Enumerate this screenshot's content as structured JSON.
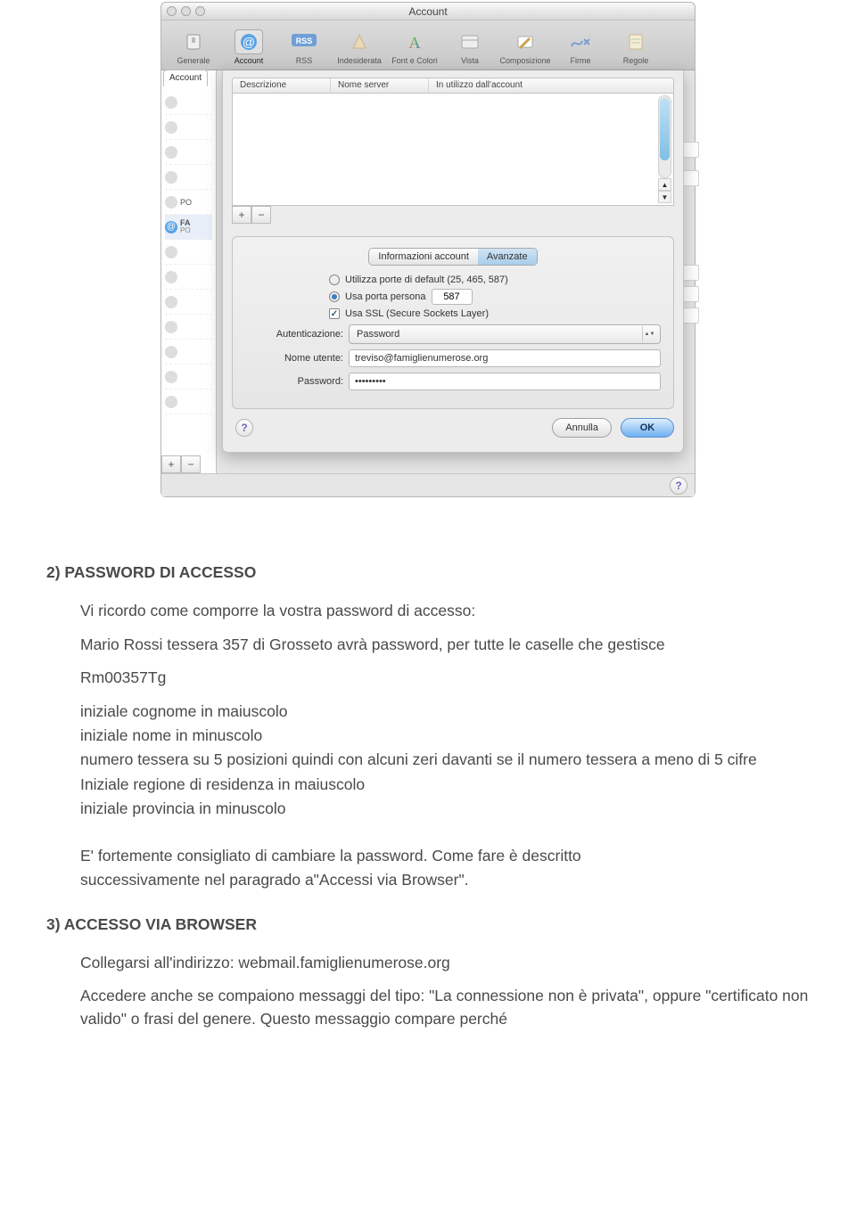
{
  "window": {
    "title": "Account"
  },
  "toolbar": {
    "items": [
      {
        "label": "Generale",
        "icon": "slider-icon"
      },
      {
        "label": "Account",
        "icon": "at-icon",
        "selected": true
      },
      {
        "label": "RSS",
        "icon": "rss-icon"
      },
      {
        "label": "Indesiderata",
        "icon": "junk-icon"
      },
      {
        "label": "Font e Colori",
        "icon": "font-icon"
      },
      {
        "label": "Vista",
        "icon": "view-icon"
      },
      {
        "label": "Composizione",
        "icon": "compose-icon"
      },
      {
        "label": "Firme",
        "icon": "sign-icon"
      },
      {
        "label": "Regole",
        "icon": "rules-icon"
      }
    ]
  },
  "sidebar": {
    "tab": "Account",
    "rows": [
      {
        "sub": "PO"
      },
      {
        "main": "FA",
        "sub": "PO"
      }
    ]
  },
  "table": {
    "headers": [
      "Descrizione",
      "Nome server",
      "In utilizzo dall'account"
    ]
  },
  "segmented": {
    "left": "Informazioni account",
    "right": "Avanzate"
  },
  "options": {
    "default_label": "Utilizza porte di default (25, 465, 587)",
    "custom_label": "Usa porta persona",
    "custom_value": "587",
    "ssl_label": "Usa SSL (Secure Sockets Layer)"
  },
  "form": {
    "auth_label": "Autenticazione:",
    "auth_value": "Password",
    "user_label": "Nome utente:",
    "user_value": "treviso@famiglienumerose.org",
    "pwd_label": "Password:",
    "pwd_value": "•••••••••"
  },
  "buttons": {
    "cancel": "Annulla",
    "ok": "OK",
    "plus": "+",
    "minus": "−",
    "help": "?"
  },
  "doc": {
    "h1": "2) PASSWORD DI ACCESSO",
    "p1": "Vi ricordo come comporre la vostra password di accesso:",
    "p2": "Mario Rossi tessera 357 di Grosseto avrà password, per tutte le caselle che gestisce",
    "p3": "Rm00357Tg",
    "l1": "iniziale cognome in maiuscolo",
    "l2": "iniziale nome in minuscolo",
    "l3": "numero tessera su 5 posizioni quindi con alcuni zeri davanti se il numero tessera a meno di 5 cifre",
    "l4": "Iniziale regione di residenza in maiuscolo",
    "l5": "iniziale provincia in minuscolo",
    "p4a": "E' fortemente consigliato di cambiare la password. Come fare è descritto",
    "p4b": "successivamente nel paragrado a\"Accessi via Browser\".",
    "h2": "3) ACCESSO VIA BROWSER",
    "p5": "Collegarsi all'indirizzo: webmail.famiglienumerose.org",
    "p6": "Accedere anche se compaiono messaggi del tipo: \"La connessione non è privata\", oppure \"certificato non valido\" o frasi del genere. Questo messaggio compare perché"
  }
}
